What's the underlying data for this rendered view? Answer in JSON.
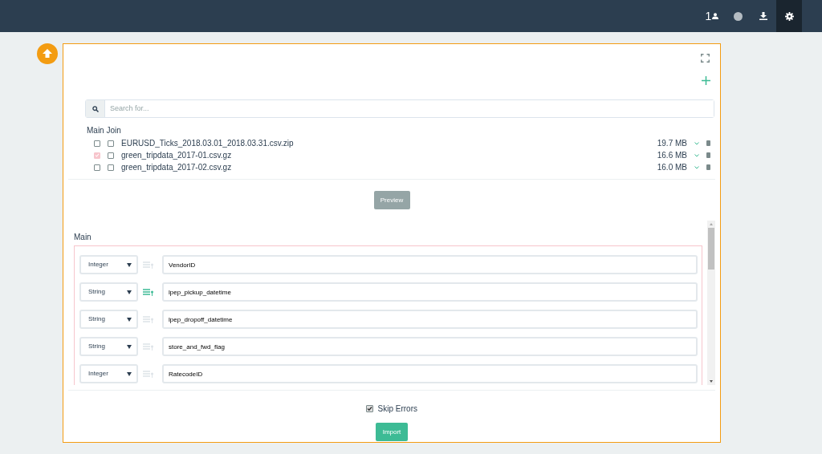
{
  "topbar": {
    "user_count": "1"
  },
  "search": {
    "placeholder": "Search for..."
  },
  "file_headers": [
    "Main",
    "Join"
  ],
  "files": [
    {
      "name": "EURUSD_Ticks_2018.03.01_2018.03.31.csv.zip",
      "size": "19.7 MB",
      "main": false,
      "join": false
    },
    {
      "name": "green_tripdata_2017-01.csv.gz",
      "size": "16.6 MB",
      "main": true,
      "join": false
    },
    {
      "name": "green_tripdata_2017-02.csv.gz",
      "size": "16.0 MB",
      "main": false,
      "join": false
    }
  ],
  "preview_button": "Preview",
  "section_title": "Main",
  "columns": [
    {
      "type": "Integer",
      "key": false,
      "name": "VendorID"
    },
    {
      "type": "String",
      "key": true,
      "name": "lpep_pickup_datetime"
    },
    {
      "type": "String",
      "key": false,
      "name": "lpep_dropoff_datetime"
    },
    {
      "type": "String",
      "key": false,
      "name": "store_and_fwd_flag"
    },
    {
      "type": "Integer",
      "key": false,
      "name": "RatecodeID"
    }
  ],
  "skip_errors": {
    "label": "Skip Errors",
    "checked": true
  },
  "import_button": "Import"
}
